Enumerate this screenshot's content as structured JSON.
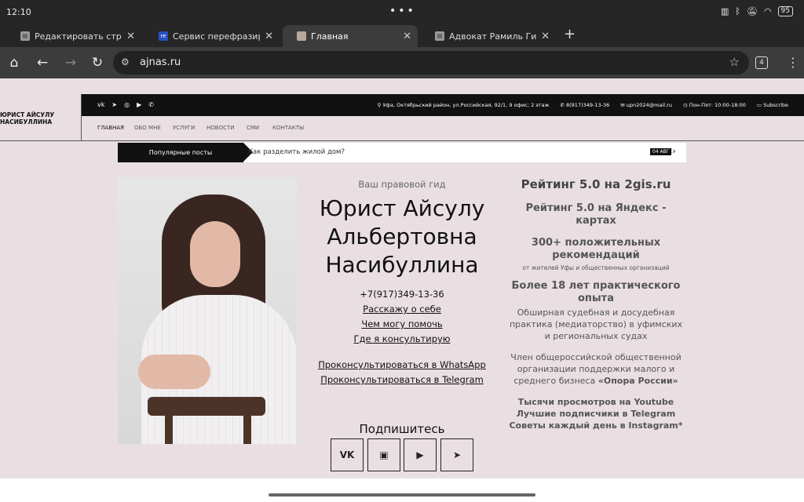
{
  "status": {
    "time": "12:10",
    "battery": "95"
  },
  "tabs": [
    {
      "label": "Редактировать страницу “",
      "favicon": "page-icon"
    },
    {
      "label": "Сервис перефразировани",
      "favicon": "rewrite-icon"
    },
    {
      "label": "Главная",
      "favicon": "site-photo-icon"
    },
    {
      "label": "Адвокат Рамиль Гизатулли",
      "favicon": "page-icon"
    }
  ],
  "omnibox": {
    "url": "ajnas.ru"
  },
  "tab_count": "4",
  "site": {
    "logo": "ЮРИСТ АЙСУЛУ НАСИБУЛЛИНА",
    "address": "Уфа, Октябрьский район, ул.Российская, 92/1, 9 офис; 2 этаж",
    "phone": "8(917)349-13-36",
    "email": "upn2024@mail.ru",
    "hours": "Пон-Пят: 10:00-18:00",
    "subscribe_top": "Subscribe",
    "nav": [
      "ГЛАВНАЯ",
      "ОБО МНЕ",
      "УСЛУГИ",
      "НОВОСТИ",
      "СМИ",
      "КОНТАКТЫ"
    ],
    "popular": {
      "label": "Популярные посты",
      "post": "Как разделить жилой дом?",
      "date": "04 АВГ"
    }
  },
  "hero": {
    "guide": "Ваш правовой гид",
    "name_lines": [
      "Юрист Айсулу",
      "Альбертовна",
      "Насибуллина"
    ],
    "phone": "+7(917)349-13-36",
    "links": [
      "Расскажу о себе",
      "Чем могу помочь",
      "Где я консультирую"
    ],
    "consult": [
      "Проконсультироваться в WhatsApp",
      "Проконсультироваться в Telegram"
    ],
    "subscribe": "Подпишитесь",
    "social": [
      "VK",
      "▣",
      "▶",
      "➤"
    ]
  },
  "right": {
    "rating_2gis": "Рейтинг 5.0 на 2gis.ru",
    "rating_yandex": "Рейтинг 5.0 на Яндекс - картах",
    "recs_title": "300+ положительных рекомендаций",
    "recs_sub": "от жителей Уфы и общественных организаций",
    "exp_title": "Более 18 лет практического опыта",
    "exp_text": "Обширная судебная и досудебная практика (медиаторство) в уфимских и региональных судах",
    "member_text": "Член общероссийской общественной организации поддержки малого и среднего бизнеса",
    "member_bold": "«Опора России»",
    "bottom": [
      "Тысячи просмотров на Youtube",
      "Лучшие подписчики в Telegram",
      "Советы каждый день в Instagram*"
    ]
  }
}
